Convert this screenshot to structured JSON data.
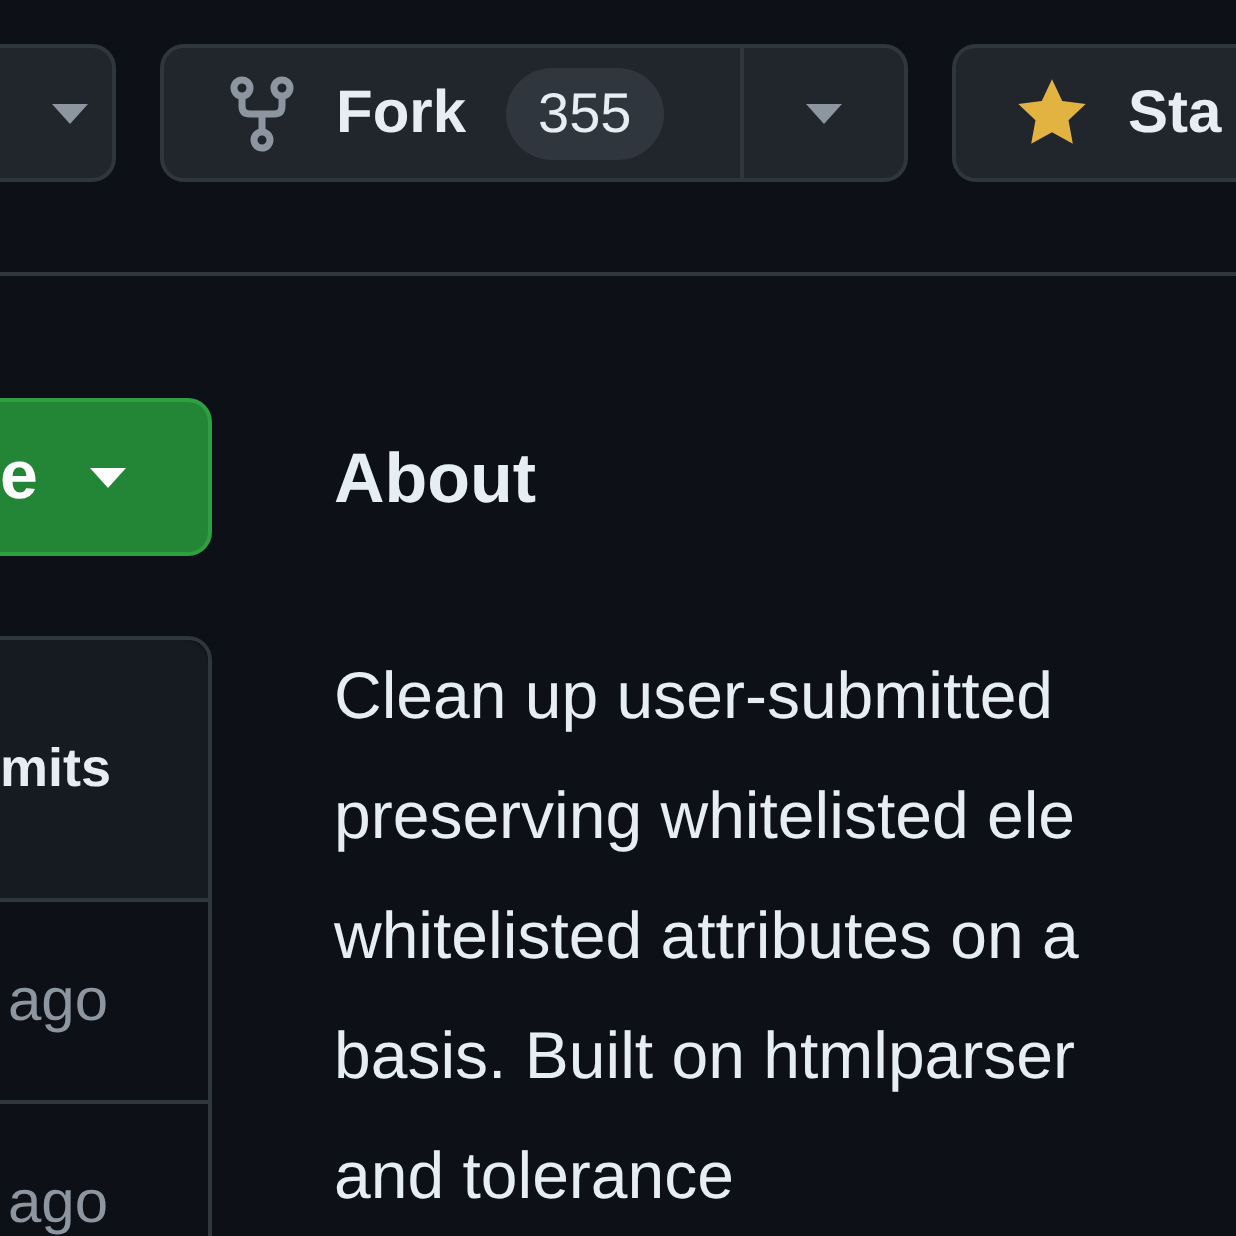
{
  "top_actions": {
    "fork": {
      "label": "Fork",
      "count": "355"
    },
    "star": {
      "label": "Sta"
    }
  },
  "code_button": {
    "label": "e"
  },
  "commits_panel": {
    "header": "mits",
    "rows": [
      {
        "time": "ago"
      },
      {
        "time": "ago"
      }
    ]
  },
  "about": {
    "title": "About",
    "description_lines": [
      "Clean up user-submitted",
      "preserving whitelisted ele",
      "whitelisted attributes on a",
      "basis. Built on htmlparser",
      "and tolerance"
    ]
  }
}
